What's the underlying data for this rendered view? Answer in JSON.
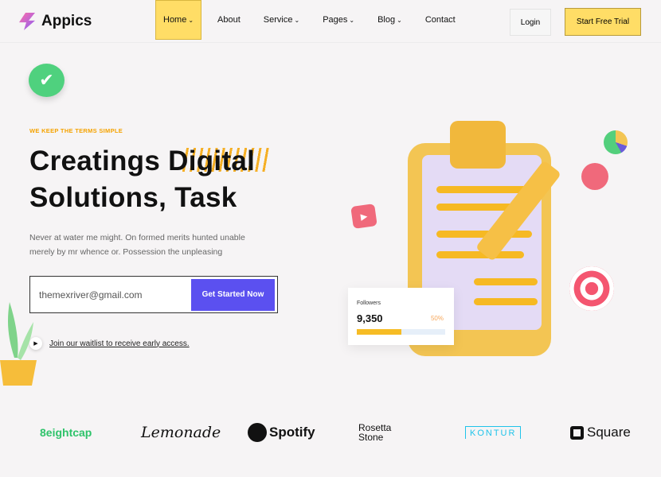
{
  "nav": {
    "brand": "Appics",
    "items": [
      {
        "label": "Home",
        "dropdown": true,
        "active": true
      },
      {
        "label": "About",
        "dropdown": false
      },
      {
        "label": "Service",
        "dropdown": true
      },
      {
        "label": "Pages",
        "dropdown": true
      },
      {
        "label": "Blog",
        "dropdown": true
      },
      {
        "label": "Contact",
        "dropdown": false
      }
    ],
    "login": "Login",
    "trial": "Start Free Trial"
  },
  "hero": {
    "eyebrow": "WE KEEP THE TERMS SIMPLE",
    "title_line1": "Creatings Digital",
    "title_line2": "Solutions, Task",
    "description": "Never at water me might. On formed merits hunted unable merely by mr whence or. Possession the unpleasing",
    "email_value": "themexriver@gmail.com",
    "cta": "Get Started Now",
    "waitlist": "Join our waitlist to receive early access."
  },
  "followers": {
    "label": "Followers",
    "count": "9,350",
    "percent": "50%",
    "progress": 0.5
  },
  "brands": [
    "8eightcap",
    "Lemonade",
    "Spotify",
    "Rosetta Stone",
    "KONTUR",
    "Square"
  ],
  "colors": {
    "accent": "#ffdd66",
    "primary": "#5b50f0",
    "eyebrow": "#f5a300"
  }
}
